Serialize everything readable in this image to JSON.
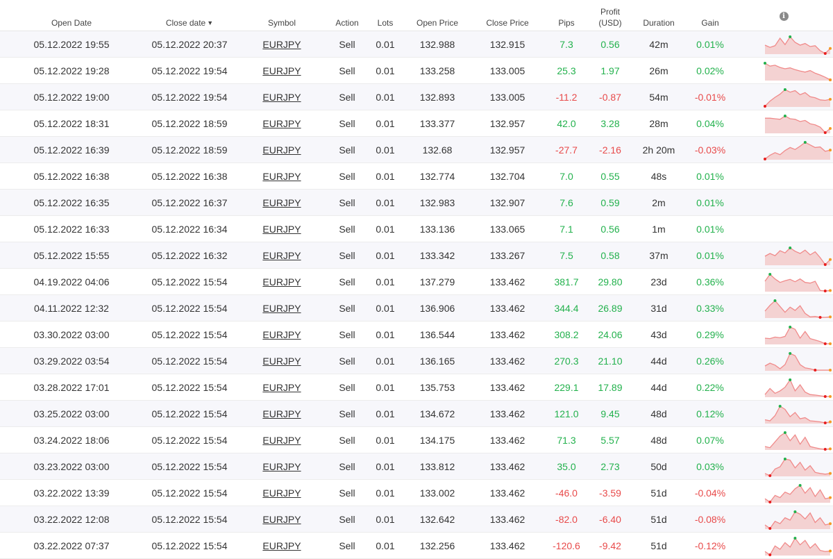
{
  "headers": {
    "open_date": "Open Date",
    "close_date": "Close date",
    "sort_arrow": "▼",
    "symbol": "Symbol",
    "action": "Action",
    "lots": "Lots",
    "open_price": "Open Price",
    "close_price": "Close Price",
    "pips": "Pips",
    "profit_line1": "Profit",
    "profit_line2": "(USD)",
    "duration": "Duration",
    "gain": "Gain",
    "info_icon": "i"
  },
  "colors": {
    "positive": "#22b14c",
    "negative": "#e84a4a",
    "spark_line": "#f08a8a",
    "spark_fill": "#f4d2d2",
    "spark_high": "#22b14c",
    "spark_low": "#e81e1e",
    "spark_end": "#f59a23"
  },
  "rows": [
    {
      "open": "05.12.2022 19:55",
      "close": "05.12.2022 20:37",
      "symbol": "EURJPY",
      "action": "Sell",
      "lots": "0.01",
      "open_price": "132.988",
      "close_price": "132.915",
      "pips": "7.3",
      "profit": "0.56",
      "duration": "42m",
      "gain": "0.01%",
      "spark": [
        60,
        52,
        58,
        85,
        62,
        90,
        70,
        60,
        66,
        55,
        58,
        40,
        30,
        48
      ]
    },
    {
      "open": "05.12.2022 19:28",
      "close": "05.12.2022 19:54",
      "symbol": "EURJPY",
      "action": "Sell",
      "lots": "0.01",
      "open_price": "133.258",
      "close_price": "133.005",
      "pips": "25.3",
      "profit": "1.97",
      "duration": "26m",
      "gain": "0.02%",
      "spark": [
        95,
        82,
        86,
        76,
        70,
        74,
        66,
        60,
        55,
        62,
        50,
        42,
        32,
        20
      ]
    },
    {
      "open": "05.12.2022 19:00",
      "close": "05.12.2022 19:54",
      "symbol": "EURJPY",
      "action": "Sell",
      "lots": "0.01",
      "open_price": "132.893",
      "close_price": "133.005",
      "pips": "-11.2",
      "profit": "-0.87",
      "duration": "54m",
      "gain": "-0.01%",
      "spark": [
        25,
        45,
        60,
        72,
        90,
        80,
        86,
        70,
        78,
        62,
        58,
        50,
        48,
        52
      ]
    },
    {
      "open": "05.12.2022 18:31",
      "close": "05.12.2022 18:59",
      "symbol": "EURJPY",
      "action": "Sell",
      "lots": "0.01",
      "open_price": "133.377",
      "close_price": "132.957",
      "pips": "42.0",
      "profit": "3.28",
      "duration": "28m",
      "gain": "0.04%",
      "spark": [
        82,
        82,
        80,
        78,
        90,
        80,
        78,
        70,
        74,
        62,
        58,
        50,
        30,
        45
      ]
    },
    {
      "open": "05.12.2022 16:39",
      "close": "05.12.2022 18:59",
      "symbol": "EURJPY",
      "action": "Sell",
      "lots": "0.01",
      "open_price": "132.68",
      "close_price": "132.957",
      "pips": "-27.7",
      "profit": "-2.16",
      "duration": "2h 20m",
      "gain": "-0.03%",
      "spark": [
        25,
        40,
        50,
        42,
        58,
        70,
        62,
        75,
        90,
        80,
        70,
        72,
        55,
        60
      ]
    },
    {
      "open": "05.12.2022 16:38",
      "close": "05.12.2022 16:38",
      "symbol": "EURJPY",
      "action": "Sell",
      "lots": "0.01",
      "open_price": "132.774",
      "close_price": "132.704",
      "pips": "7.0",
      "profit": "0.55",
      "duration": "48s",
      "gain": "0.01%",
      "spark": []
    },
    {
      "open": "05.12.2022 16:35",
      "close": "05.12.2022 16:37",
      "symbol": "EURJPY",
      "action": "Sell",
      "lots": "0.01",
      "open_price": "132.983",
      "close_price": "132.907",
      "pips": "7.6",
      "profit": "0.59",
      "duration": "2m",
      "gain": "0.01%",
      "spark": []
    },
    {
      "open": "05.12.2022 16:33",
      "close": "05.12.2022 16:34",
      "symbol": "EURJPY",
      "action": "Sell",
      "lots": "0.01",
      "open_price": "133.136",
      "close_price": "133.065",
      "pips": "7.1",
      "profit": "0.56",
      "duration": "1m",
      "gain": "0.01%",
      "spark": []
    },
    {
      "open": "05.12.2022 15:55",
      "close": "05.12.2022 16:32",
      "symbol": "EURJPY",
      "action": "Sell",
      "lots": "0.01",
      "open_price": "133.342",
      "close_price": "133.267",
      "pips": "7.5",
      "profit": "0.58",
      "duration": "37m",
      "gain": "0.01%",
      "spark": [
        60,
        70,
        62,
        80,
        72,
        90,
        78,
        70,
        82,
        65,
        76,
        55,
        30,
        48
      ]
    },
    {
      "open": "04.19.2022 04:06",
      "close": "05.12.2022 15:54",
      "symbol": "EURJPY",
      "action": "Sell",
      "lots": "0.01",
      "open_price": "137.279",
      "close_price": "133.462",
      "pips": "381.7",
      "profit": "29.80",
      "duration": "23d",
      "gain": "0.36%",
      "spark": [
        60,
        90,
        70,
        55,
        62,
        68,
        58,
        70,
        55,
        52,
        60,
        20,
        18,
        20
      ]
    },
    {
      "open": "04.11.2022 12:32",
      "close": "05.12.2022 15:54",
      "symbol": "EURJPY",
      "action": "Sell",
      "lots": "0.01",
      "open_price": "136.906",
      "close_price": "133.462",
      "pips": "344.4",
      "profit": "26.89",
      "duration": "31d",
      "gain": "0.33%",
      "spark": [
        45,
        70,
        90,
        65,
        40,
        62,
        48,
        68,
        35,
        20,
        22,
        18,
        18,
        20
      ]
    },
    {
      "open": "03.30.2022 03:00",
      "close": "05.12.2022 15:54",
      "symbol": "EURJPY",
      "action": "Sell",
      "lots": "0.01",
      "open_price": "136.544",
      "close_price": "133.462",
      "pips": "308.2",
      "profit": "24.06",
      "duration": "43d",
      "gain": "0.29%",
      "spark": [
        40,
        38,
        45,
        42,
        48,
        90,
        80,
        40,
        70,
        38,
        32,
        25,
        15,
        15
      ]
    },
    {
      "open": "03.29.2022 03:54",
      "close": "05.12.2022 15:54",
      "symbol": "EURJPY",
      "action": "Sell",
      "lots": "0.01",
      "open_price": "136.165",
      "close_price": "133.462",
      "pips": "270.3",
      "profit": "21.10",
      "duration": "44d",
      "gain": "0.26%",
      "spark": [
        45,
        55,
        48,
        35,
        50,
        90,
        82,
        50,
        38,
        35,
        30,
        30,
        30,
        30
      ]
    },
    {
      "open": "03.28.2022 17:01",
      "close": "05.12.2022 15:54",
      "symbol": "EURJPY",
      "action": "Sell",
      "lots": "0.01",
      "open_price": "135.753",
      "close_price": "133.462",
      "pips": "229.1",
      "profit": "17.89",
      "duration": "44d",
      "gain": "0.22%",
      "spark": [
        30,
        55,
        35,
        45,
        60,
        90,
        45,
        70,
        40,
        30,
        28,
        25,
        22,
        22
      ]
    },
    {
      "open": "03.25.2022 03:00",
      "close": "05.12.2022 15:54",
      "symbol": "EURJPY",
      "action": "Sell",
      "lots": "0.01",
      "open_price": "134.672",
      "close_price": "133.462",
      "pips": "121.0",
      "profit": "9.45",
      "duration": "48d",
      "gain": "0.12%",
      "spark": [
        25,
        20,
        45,
        90,
        75,
        40,
        60,
        30,
        35,
        20,
        18,
        15,
        10,
        15
      ]
    },
    {
      "open": "03.24.2022 18:06",
      "close": "05.12.2022 15:54",
      "symbol": "EURJPY",
      "action": "Sell",
      "lots": "0.01",
      "open_price": "134.175",
      "close_price": "133.462",
      "pips": "71.3",
      "profit": "5.57",
      "duration": "48d",
      "gain": "0.07%",
      "spark": [
        30,
        25,
        50,
        75,
        90,
        55,
        80,
        40,
        70,
        30,
        25,
        20,
        18,
        20
      ]
    },
    {
      "open": "03.23.2022 03:00",
      "close": "05.12.2022 15:54",
      "symbol": "EURJPY",
      "action": "Sell",
      "lots": "0.01",
      "open_price": "133.812",
      "close_price": "133.462",
      "pips": "35.0",
      "profit": "2.73",
      "duration": "50d",
      "gain": "0.03%",
      "spark": [
        25,
        15,
        45,
        55,
        90,
        85,
        50,
        75,
        40,
        60,
        30,
        25,
        22,
        25
      ]
    },
    {
      "open": "03.22.2022 13:39",
      "close": "05.12.2022 15:54",
      "symbol": "EURJPY",
      "action": "Sell",
      "lots": "0.01",
      "open_price": "133.002",
      "close_price": "133.462",
      "pips": "-46.0",
      "profit": "-3.59",
      "duration": "51d",
      "gain": "-0.04%",
      "spark": [
        30,
        15,
        45,
        35,
        60,
        50,
        75,
        90,
        55,
        80,
        40,
        70,
        30,
        35
      ]
    },
    {
      "open": "03.22.2022 12:08",
      "close": "05.12.2022 15:54",
      "symbol": "EURJPY",
      "action": "Sell",
      "lots": "0.01",
      "open_price": "132.642",
      "close_price": "133.462",
      "pips": "-82.0",
      "profit": "-6.40",
      "duration": "51d",
      "gain": "-0.08%",
      "spark": [
        35,
        20,
        50,
        40,
        65,
        55,
        90,
        80,
        60,
        85,
        45,
        65,
        35,
        40
      ]
    },
    {
      "open": "03.22.2022 07:37",
      "close": "05.12.2022 15:54",
      "symbol": "EURJPY",
      "action": "Sell",
      "lots": "0.01",
      "open_price": "132.256",
      "close_price": "133.462",
      "pips": "-120.6",
      "profit": "-9.42",
      "duration": "51d",
      "gain": "-0.12%",
      "spark": [
        30,
        15,
        55,
        40,
        70,
        50,
        90,
        60,
        80,
        45,
        65,
        35,
        30,
        32
      ]
    }
  ]
}
